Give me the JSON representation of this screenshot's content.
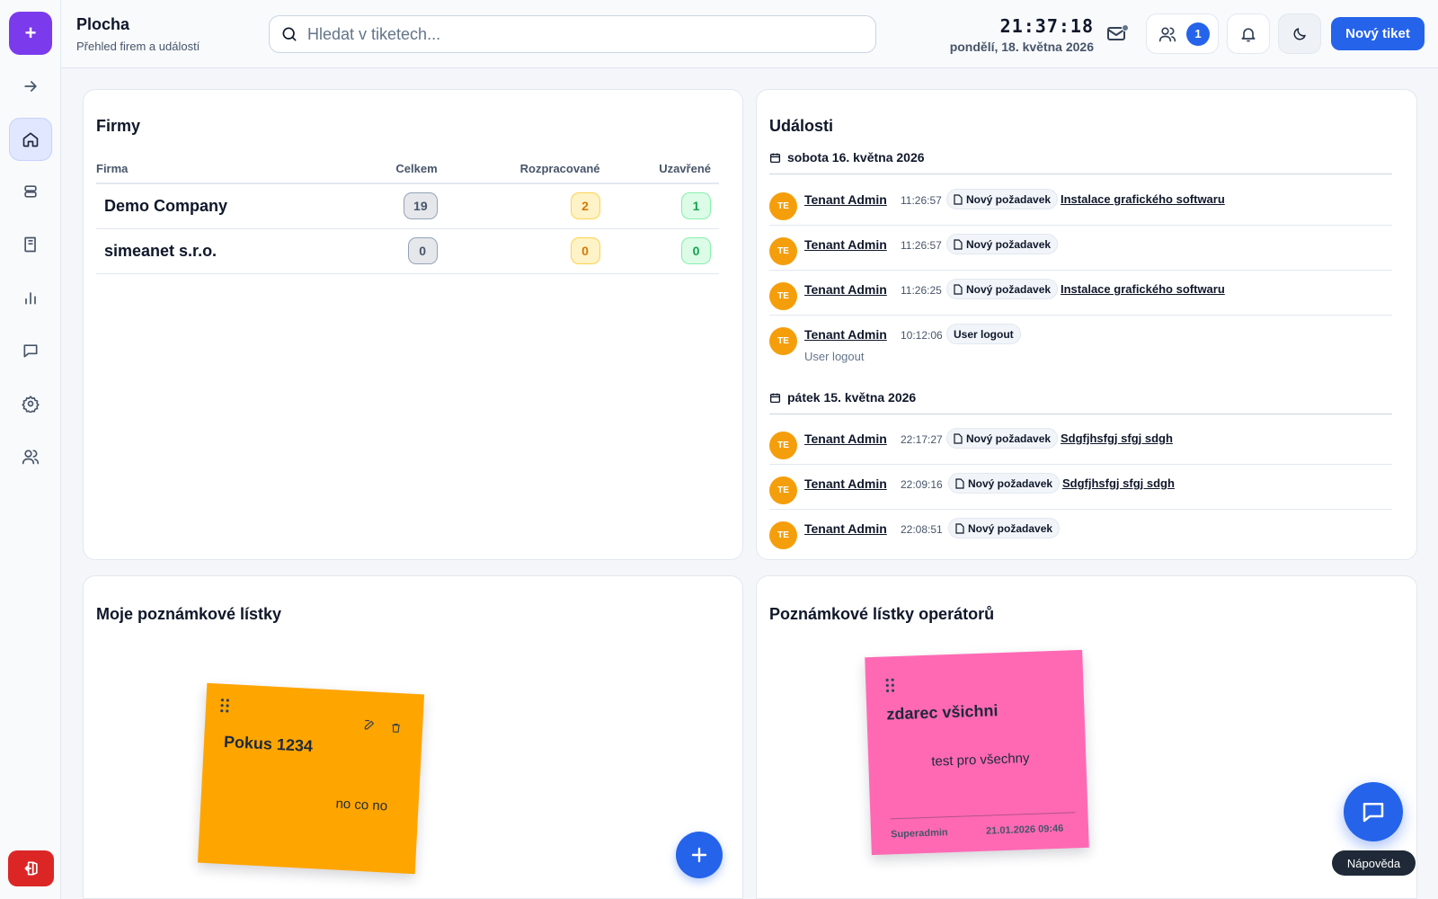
{
  "header": {
    "title": "Plocha",
    "subtitle": "Přehled firem a událostí",
    "search_placeholder": "Hledat v tiketech...",
    "time": "21:37:18",
    "date": "pondělí, 18. května 2026",
    "users_count": "1",
    "new_ticket_label": "Nový tiket"
  },
  "sidebar": {
    "items": [
      "arrow-right-icon",
      "home-icon",
      "database-icon",
      "book-icon",
      "chart-icon",
      "chat-icon",
      "gear-icon",
      "users-icon"
    ],
    "active": "home-icon"
  },
  "firms": {
    "title": "Firmy",
    "columns": [
      "Firma",
      "Celkem",
      "Rozpracované",
      "Uzavřené"
    ],
    "rows": [
      {
        "name": "Demo Company",
        "total": "19",
        "in_progress": "2",
        "closed": "1"
      },
      {
        "name": "simeanet s.r.o.",
        "total": "0",
        "in_progress": "0",
        "closed": "0"
      }
    ]
  },
  "events": {
    "title": "Události",
    "groups": [
      {
        "date": "sobota 16. května 2026",
        "items": [
          {
            "initials": "TE",
            "user": "Tenant Admin",
            "time": "11:26:57",
            "type": "Nový požadavek",
            "link": "Instalace grafického softwaru"
          },
          {
            "initials": "TE",
            "user": "Tenant Admin",
            "time": "11:26:57",
            "type": "Nový požadavek",
            "link": ""
          },
          {
            "initials": "TE",
            "user": "Tenant Admin",
            "time": "11:26:25",
            "type": "Nový požadavek",
            "link": "Instalace grafického softwaru"
          },
          {
            "initials": "TE",
            "user": "Tenant Admin",
            "time": "10:12:06",
            "type": "User logout",
            "link": "",
            "detail": "User logout"
          }
        ]
      },
      {
        "date": "pátek 15. května 2026",
        "items": [
          {
            "initials": "TE",
            "user": "Tenant Admin",
            "time": "22:17:27",
            "type": "Nový požadavek",
            "link": "Sdgfjhsfgj sfgj sdgh"
          },
          {
            "initials": "TE",
            "user": "Tenant Admin",
            "time": "22:09:16",
            "type": "Nový požadavek",
            "link": "Sdgfjhsfgj sfgj sdgh"
          },
          {
            "initials": "TE",
            "user": "Tenant Admin",
            "time": "22:08:51",
            "type": "Nový požadavek",
            "link": ""
          }
        ]
      }
    ]
  },
  "my_notes": {
    "title": "Moje poznámkové lístky",
    "note": {
      "title": "Pokus 1234",
      "body": "no co no",
      "color": "#ffa500"
    }
  },
  "operator_notes": {
    "title": "Poznámkové lístky operátorů",
    "note": {
      "title": "zdarec všichni",
      "body": "test pro všechny",
      "author": "Superadmin",
      "timestamp": "21.01.2026 09:46",
      "color": "#ff69b4"
    }
  },
  "help": {
    "label": "Nápověda"
  },
  "colors": {
    "accent": "#2563eb",
    "brand": "#7c3aed",
    "avatar": "#f59e0b",
    "danger": "#dc2626"
  }
}
